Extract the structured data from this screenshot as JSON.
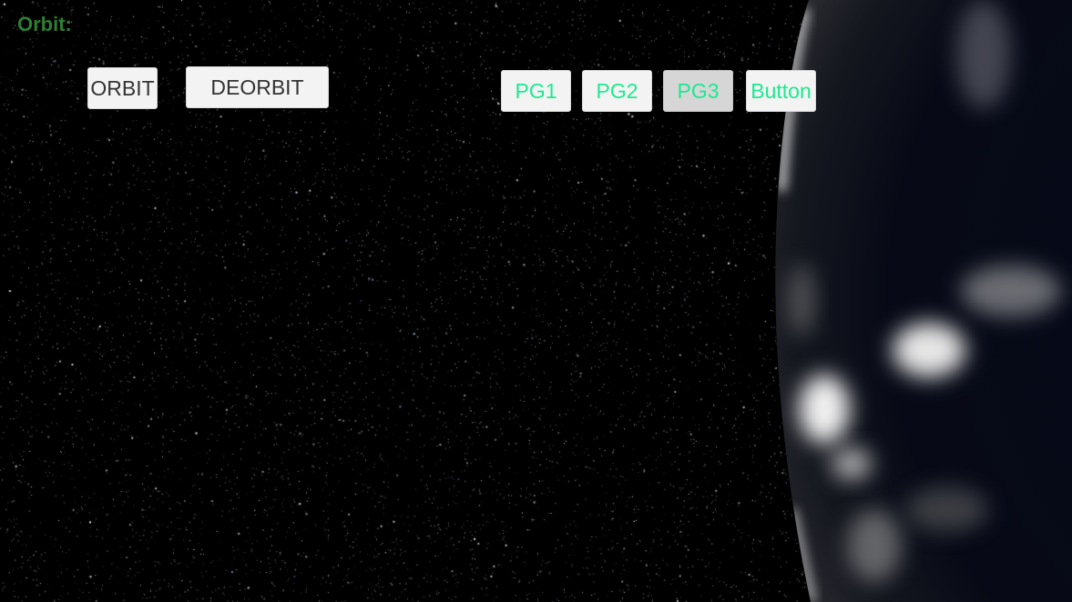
{
  "hud": {
    "orbit_label": "Orbit:",
    "orbit_button": "ORBIT",
    "deorbit_button": "DEORBIT"
  },
  "page_buttons": [
    {
      "label": "PG1",
      "state": "normal"
    },
    {
      "label": "PG2",
      "state": "normal"
    },
    {
      "label": "PG3",
      "state": "pressed"
    },
    {
      "label": "Button",
      "state": "normal"
    }
  ],
  "colors": {
    "orbit_label": "#2e7d32",
    "page_button_text": "#1de991",
    "button_background": "#f3f3f3",
    "pressed_background": "#d6d6d6",
    "space": "#000000",
    "planet_shadow": "#050814"
  }
}
